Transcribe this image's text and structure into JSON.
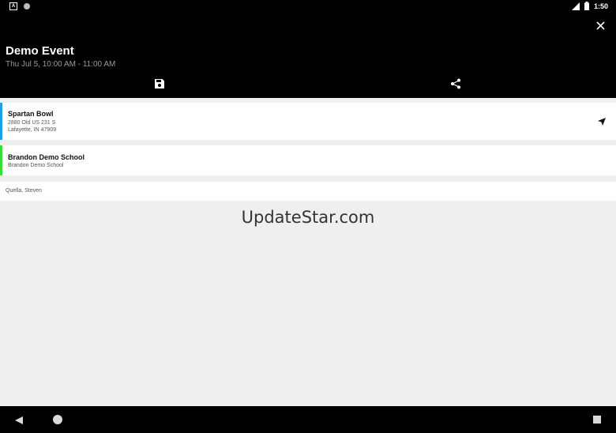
{
  "status_bar": {
    "time": "1:50",
    "left_icons": [
      "a-notification-icon",
      "sync-icon"
    ],
    "right_icons": [
      "signal-icon",
      "battery-icon"
    ]
  },
  "header": {
    "title": "Demo Event",
    "subtitle": "Thu Jul 5, 10:00 AM - 11:00 AM",
    "actions": [
      "save-icon",
      "share-icon"
    ],
    "close_icon": "close-icon"
  },
  "locations": [
    {
      "name": "Spartan Bowl",
      "line1": "2880 Old US 231 S",
      "line2": "Lafayette, IN 47909",
      "accent": "#1aa3e8",
      "icon": "navigation-icon"
    },
    {
      "name": "Brandon Demo School",
      "line1": "Brandon Demo School",
      "accent": "#35e03a"
    }
  ],
  "assignee": "Quella, Steven",
  "watermark": "UpdateStar.com",
  "colors": {
    "header_bg": "#000000",
    "page_bg": "#efefef",
    "card_bg": "#ffffff"
  }
}
